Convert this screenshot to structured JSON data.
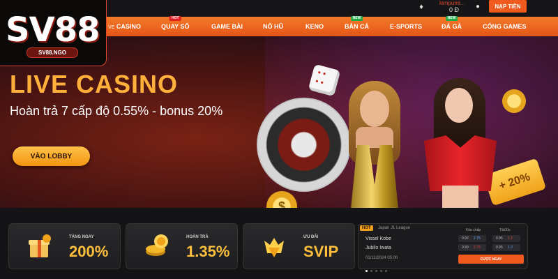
{
  "logo": {
    "brand": "SV88",
    "domain": "SV88.NGO"
  },
  "topbar": {
    "user_name": "kimpuml...",
    "balance": "0 Đ",
    "deposit_label": "NẠP TIỀN"
  },
  "nav": {
    "items": [
      {
        "label": "CASINO",
        "prefix": "VE",
        "badge": ""
      },
      {
        "label": "QUAY SỐ",
        "badge": "HOT"
      },
      {
        "label": "GAME BÀI",
        "badge": ""
      },
      {
        "label": "NỔ HŨ",
        "badge": ""
      },
      {
        "label": "KENO",
        "badge": ""
      },
      {
        "label": "BẮN CÁ",
        "badge": "NEW"
      },
      {
        "label": "E-SPORTS",
        "badge": ""
      },
      {
        "label": "ĐÁ GÀ",
        "badge": "NEW"
      },
      {
        "label": "CỔNG GAMES",
        "badge": ""
      }
    ]
  },
  "hero": {
    "title": "LIVE CASINO",
    "subtitle": "Hoàn trả 7 cấp độ 0.55% - bonus 20%",
    "button": "VÀO LOBBY",
    "coin_symbol": "$",
    "ticket_text": "+ 20%"
  },
  "promos": [
    {
      "label": "TẶNG NGAY",
      "value": "200%"
    },
    {
      "label": "HOÀN TRẢ",
      "value": "1.35%"
    },
    {
      "label": "ƯU ĐÃI",
      "value": "SVIP"
    }
  ],
  "match": {
    "hot": "HOT",
    "league": "Japan J1 League",
    "team1": "Vissel Kobe",
    "team2": "Jubilo Iwata",
    "datetime": "01/11/2024 05:00",
    "col1": "Kèo chấp",
    "col2": "Tài/Xỉu",
    "odds": {
      "r1c1": {
        "a": "0.92",
        "b": "2.75"
      },
      "r1c2": {
        "a": "0.95",
        "b": "1.2"
      },
      "r2c1": {
        "a": "0.99",
        "b": "2.75"
      },
      "r2c2": {
        "a": "0.95",
        "b": "1.2"
      }
    },
    "bet_label": "CƯỢC NGAY"
  }
}
